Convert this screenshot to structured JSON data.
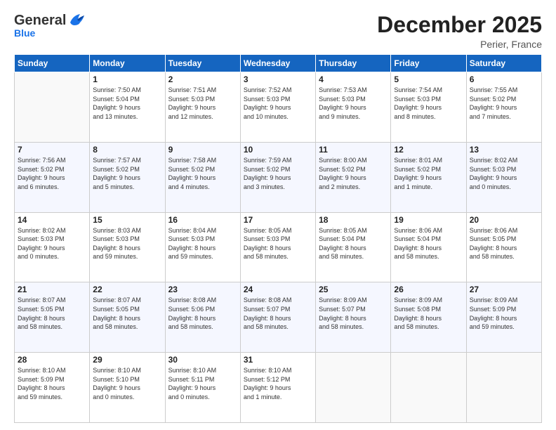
{
  "header": {
    "logo_general": "General",
    "logo_blue": "Blue",
    "month_year": "December 2025",
    "location": "Perier, France"
  },
  "days_of_week": [
    "Sunday",
    "Monday",
    "Tuesday",
    "Wednesday",
    "Thursday",
    "Friday",
    "Saturday"
  ],
  "weeks": [
    [
      {
        "num": "",
        "info": ""
      },
      {
        "num": "1",
        "info": "Sunrise: 7:50 AM\nSunset: 5:04 PM\nDaylight: 9 hours\nand 13 minutes."
      },
      {
        "num": "2",
        "info": "Sunrise: 7:51 AM\nSunset: 5:03 PM\nDaylight: 9 hours\nand 12 minutes."
      },
      {
        "num": "3",
        "info": "Sunrise: 7:52 AM\nSunset: 5:03 PM\nDaylight: 9 hours\nand 10 minutes."
      },
      {
        "num": "4",
        "info": "Sunrise: 7:53 AM\nSunset: 5:03 PM\nDaylight: 9 hours\nand 9 minutes."
      },
      {
        "num": "5",
        "info": "Sunrise: 7:54 AM\nSunset: 5:03 PM\nDaylight: 9 hours\nand 8 minutes."
      },
      {
        "num": "6",
        "info": "Sunrise: 7:55 AM\nSunset: 5:02 PM\nDaylight: 9 hours\nand 7 minutes."
      }
    ],
    [
      {
        "num": "7",
        "info": "Sunrise: 7:56 AM\nSunset: 5:02 PM\nDaylight: 9 hours\nand 6 minutes."
      },
      {
        "num": "8",
        "info": "Sunrise: 7:57 AM\nSunset: 5:02 PM\nDaylight: 9 hours\nand 5 minutes."
      },
      {
        "num": "9",
        "info": "Sunrise: 7:58 AM\nSunset: 5:02 PM\nDaylight: 9 hours\nand 4 minutes."
      },
      {
        "num": "10",
        "info": "Sunrise: 7:59 AM\nSunset: 5:02 PM\nDaylight: 9 hours\nand 3 minutes."
      },
      {
        "num": "11",
        "info": "Sunrise: 8:00 AM\nSunset: 5:02 PM\nDaylight: 9 hours\nand 2 minutes."
      },
      {
        "num": "12",
        "info": "Sunrise: 8:01 AM\nSunset: 5:02 PM\nDaylight: 9 hours\nand 1 minute."
      },
      {
        "num": "13",
        "info": "Sunrise: 8:02 AM\nSunset: 5:03 PM\nDaylight: 9 hours\nand 0 minutes."
      }
    ],
    [
      {
        "num": "14",
        "info": "Sunrise: 8:02 AM\nSunset: 5:03 PM\nDaylight: 9 hours\nand 0 minutes."
      },
      {
        "num": "15",
        "info": "Sunrise: 8:03 AM\nSunset: 5:03 PM\nDaylight: 8 hours\nand 59 minutes."
      },
      {
        "num": "16",
        "info": "Sunrise: 8:04 AM\nSunset: 5:03 PM\nDaylight: 8 hours\nand 59 minutes."
      },
      {
        "num": "17",
        "info": "Sunrise: 8:05 AM\nSunset: 5:03 PM\nDaylight: 8 hours\nand 58 minutes."
      },
      {
        "num": "18",
        "info": "Sunrise: 8:05 AM\nSunset: 5:04 PM\nDaylight: 8 hours\nand 58 minutes."
      },
      {
        "num": "19",
        "info": "Sunrise: 8:06 AM\nSunset: 5:04 PM\nDaylight: 8 hours\nand 58 minutes."
      },
      {
        "num": "20",
        "info": "Sunrise: 8:06 AM\nSunset: 5:05 PM\nDaylight: 8 hours\nand 58 minutes."
      }
    ],
    [
      {
        "num": "21",
        "info": "Sunrise: 8:07 AM\nSunset: 5:05 PM\nDaylight: 8 hours\nand 58 minutes."
      },
      {
        "num": "22",
        "info": "Sunrise: 8:07 AM\nSunset: 5:05 PM\nDaylight: 8 hours\nand 58 minutes."
      },
      {
        "num": "23",
        "info": "Sunrise: 8:08 AM\nSunset: 5:06 PM\nDaylight: 8 hours\nand 58 minutes."
      },
      {
        "num": "24",
        "info": "Sunrise: 8:08 AM\nSunset: 5:07 PM\nDaylight: 8 hours\nand 58 minutes."
      },
      {
        "num": "25",
        "info": "Sunrise: 8:09 AM\nSunset: 5:07 PM\nDaylight: 8 hours\nand 58 minutes."
      },
      {
        "num": "26",
        "info": "Sunrise: 8:09 AM\nSunset: 5:08 PM\nDaylight: 8 hours\nand 58 minutes."
      },
      {
        "num": "27",
        "info": "Sunrise: 8:09 AM\nSunset: 5:09 PM\nDaylight: 8 hours\nand 59 minutes."
      }
    ],
    [
      {
        "num": "28",
        "info": "Sunrise: 8:10 AM\nSunset: 5:09 PM\nDaylight: 8 hours\nand 59 minutes."
      },
      {
        "num": "29",
        "info": "Sunrise: 8:10 AM\nSunset: 5:10 PM\nDaylight: 9 hours\nand 0 minutes."
      },
      {
        "num": "30",
        "info": "Sunrise: 8:10 AM\nSunset: 5:11 PM\nDaylight: 9 hours\nand 0 minutes."
      },
      {
        "num": "31",
        "info": "Sunrise: 8:10 AM\nSunset: 5:12 PM\nDaylight: 9 hours\nand 1 minute."
      },
      {
        "num": "",
        "info": ""
      },
      {
        "num": "",
        "info": ""
      },
      {
        "num": "",
        "info": ""
      }
    ]
  ]
}
